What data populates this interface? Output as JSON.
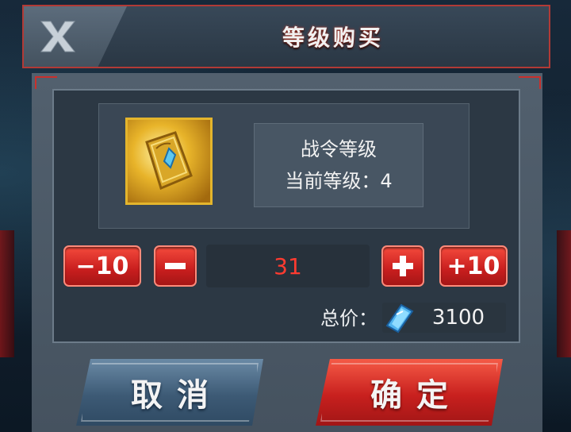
{
  "header": {
    "title": "等级购买",
    "close_label": "X"
  },
  "item": {
    "icon": "battle-pass-card-icon",
    "name": "战令等级",
    "current_level": "当前等级：4"
  },
  "stepper": {
    "minus10_label": "−10",
    "minus1_label": "−",
    "quantity": "31",
    "plus1_label": "+",
    "plus10_label": "+10"
  },
  "price": {
    "label": "总价：",
    "currency_icon": "blue-gem-icon",
    "value": "3100"
  },
  "buttons": {
    "cancel_label": "取消",
    "confirm_label": "确定"
  },
  "colors": {
    "accent_red": "#c81e1e",
    "quantity_text": "#ff3b30",
    "icon_gold": "#e4b52c",
    "cancel_blue": "#3d5a75"
  }
}
